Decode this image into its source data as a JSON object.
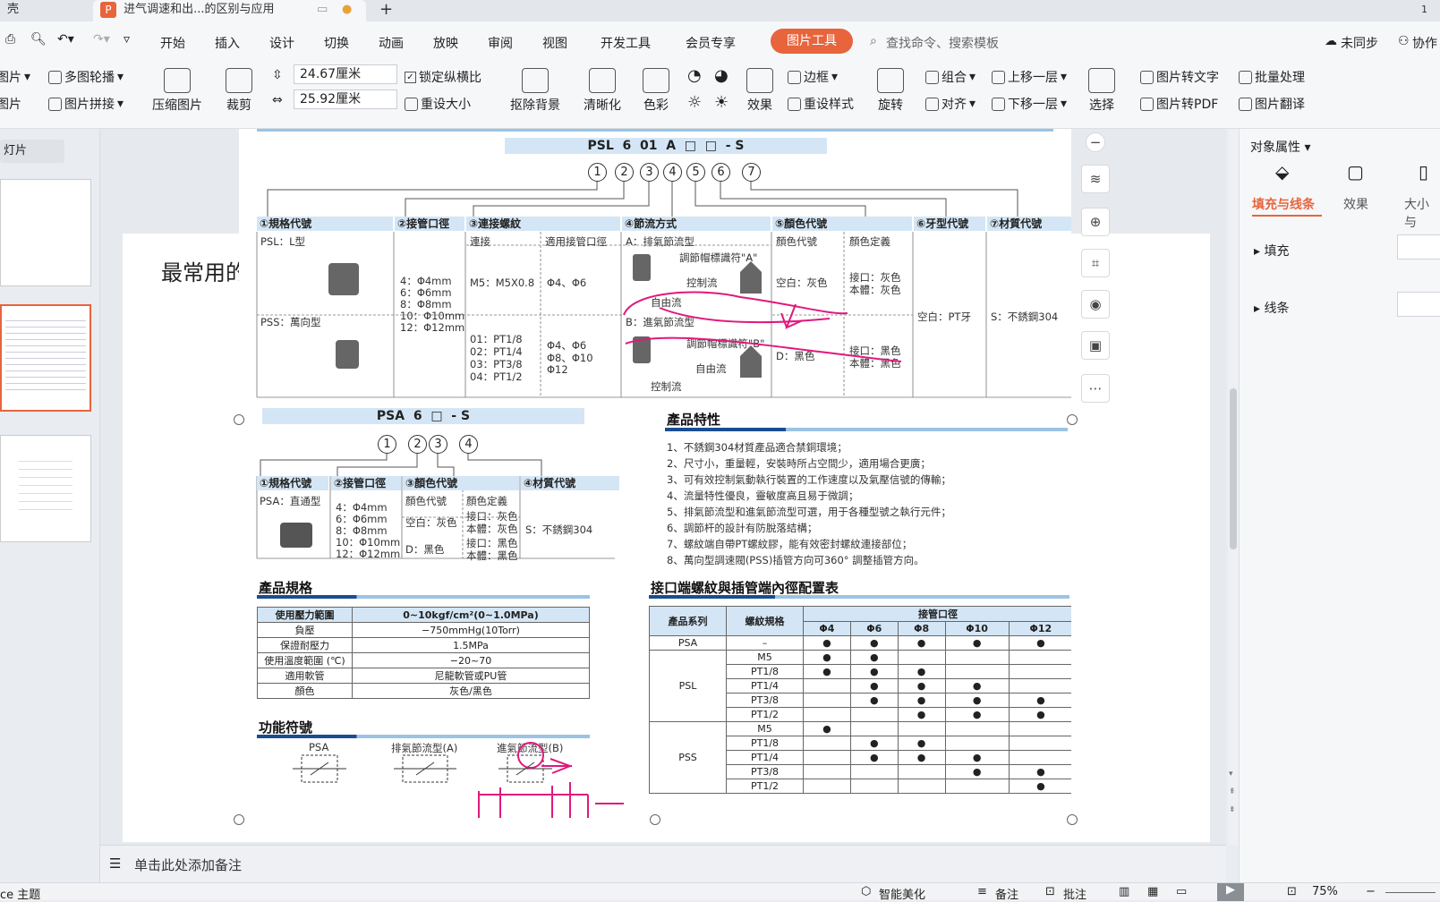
{
  "tabs": {
    "prev_partial": "壳",
    "active_title": "进气调速和出...的区别与应用",
    "new_tab": "+",
    "window_counter": "1"
  },
  "menubar": {
    "items": [
      "开始",
      "插入",
      "设计",
      "切换",
      "动画",
      "放映",
      "审阅",
      "视图",
      "开发工具",
      "会员专享"
    ],
    "active_tool_tab": "图片工具",
    "search_placeholder": "查找命令、搜索模板",
    "sync": "未同步",
    "collab": "协作"
  },
  "ribbon": {
    "left": [
      "图片",
      "图片",
      "多图轮播",
      "图片拼接",
      "压缩图片",
      "裁剪"
    ],
    "width_value": "24.67厘米",
    "height_value": "25.92厘米",
    "lock_ratio": "锁定纵横比",
    "resize": "重设大小",
    "remove_bg": "抠除背景",
    "sharpen": "清晰化",
    "color": "色彩",
    "effects": "效果",
    "border": "边框",
    "reset_style": "重设样式",
    "rotate": "旋转",
    "group": "组合",
    "align": "对齐",
    "bring_forward": "上移一层",
    "send_backward": "下移一层",
    "select": "选择",
    "pic_to_text": "图片转文字",
    "batch": "批量处理",
    "pic_to_pdf": "图片转PDF",
    "pic_translate": "图片翻译"
  },
  "left_pane": {
    "header": "灯片"
  },
  "slide": {
    "title_partial": "最常用的"
  },
  "doc": {
    "psl_code": "PSL  6  01  A  □  □  - S",
    "psl_nums": [
      "1",
      "2",
      "3",
      "4",
      "5",
      "6",
      "7"
    ],
    "psl_headers": [
      "①規格代號",
      "②接管口徑",
      "③連接螺紋",
      "④節流方式",
      "⑤顏色代號",
      "⑥牙型代號",
      "⑦材質代號"
    ],
    "psl_L": "PSL：L型",
    "pss": "PSS：萬向型",
    "pipe_sizes": [
      "4：Φ4mm",
      "6：Φ6mm",
      "8：Φ8mm",
      "10：Φ10mm",
      "12：Φ12mm"
    ],
    "thread_sub": [
      "連接",
      "適用接管口徑"
    ],
    "thread_m5": "M5：M5X0.8",
    "thread_m5_fit": "Φ4、Φ6",
    "thread_pt": [
      "01：PT1/8",
      "02：PT1/4",
      "03：PT3/8",
      "04：PT1/2"
    ],
    "thread_pt_fit": [
      "Φ4、Φ6",
      "Φ8、Φ10",
      "Φ12"
    ],
    "flow_a": "A：排氣節流型",
    "flow_cap_a": "調節帽標識符\"A\"",
    "control_flow": "控制流",
    "free_flow": "自由流",
    "flow_b": "B：進氣節流型",
    "flow_cap_b": "調節帽標識符\"B\"",
    "color_sub": [
      "顏色代號",
      "顏色定義"
    ],
    "color_blank": "空白：灰色",
    "color_def_grey": [
      "接口：灰色",
      "本體：灰色"
    ],
    "color_d": "D：黑色",
    "color_def_black": [
      "接口：黑色",
      "本體：黑色"
    ],
    "thread_type": "空白：PT牙",
    "material": "S：不銹鋼304",
    "psa_code": "PSA  6  □  - S",
    "psa_nums": [
      "1",
      "2",
      "3",
      "4"
    ],
    "psa_headers": [
      "①規格代號",
      "②接管口徑",
      "③顏色代號",
      "④材質代號"
    ],
    "psa_straight": "PSA：直通型",
    "psa_material": "S：不銹鋼304",
    "features_title": "產品特性",
    "features": [
      "1、不銹鋼304材質產品適合禁銅環境；",
      "2、尺寸小，重量輕，安裝時所占空間少，適用場合更廣；",
      "3、可有效控制氣動執行裝置的工作速度以及氣壓信號的傳輸；",
      "4、流量特性優良，靈敏度高且易于微調；",
      "5、排氣節流型和進氣節流型可選，用于各種型號之執行元件；",
      "6、調節杆的設計有防脫落結構；",
      "7、螺紋端自帶PT螺紋膠，能有效密封螺紋連接部位；",
      "8、萬向型調速閥(PSS)插管方向可360° 調整插管方向。"
    ],
    "spec_title": "產品規格",
    "spec_rows": [
      [
        "使用壓力範圍",
        "0~10kgf/cm²(0~1.0MPa)"
      ],
      [
        "負壓",
        "−750mmHg(10Torr)"
      ],
      [
        "保證耐壓力",
        "1.5MPa"
      ],
      [
        "使用溫度範圍 (℃)",
        "−20~70"
      ],
      [
        "適用軟管",
        "尼龍軟管或PU管"
      ],
      [
        "顏色",
        "灰色/黑色"
      ]
    ],
    "func_title": "功能符號",
    "func_labels": [
      "PSA",
      "排氣節流型(A)",
      "進氣節流型(B)"
    ],
    "port_title": "接口端螺紋與插管端內徑配置表",
    "port_head": [
      "產品系列",
      "螺紋規格",
      "接管口徑"
    ],
    "port_sizes": [
      "Φ4",
      "Φ6",
      "Φ8",
      "Φ10",
      "Φ12"
    ],
    "port_rows": [
      [
        "PSA",
        "–",
        "●",
        "●",
        "●",
        "●",
        "●"
      ],
      [
        "PSL",
        "M5",
        "●",
        "●",
        "",
        "",
        ""
      ],
      [
        "",
        "PT1/8",
        "●",
        "●",
        "●",
        "",
        ""
      ],
      [
        "",
        "PT1/4",
        "",
        "●",
        "●",
        "●",
        ""
      ],
      [
        "",
        "PT3/8",
        "",
        "●",
        "●",
        "●",
        "●"
      ],
      [
        "",
        "PT1/2",
        "",
        "",
        "●",
        "●",
        "●"
      ],
      [
        "PSS",
        "M5",
        "●",
        "",
        "",
        "",
        ""
      ],
      [
        "",
        "PT1/8",
        "",
        "●",
        "●",
        "",
        ""
      ],
      [
        "",
        "PT1/4",
        "",
        "●",
        "●",
        "●",
        ""
      ],
      [
        "",
        "PT3/8",
        "",
        "",
        "",
        "●",
        "●"
      ],
      [
        "",
        "PT1/2",
        "",
        "",
        "",
        "",
        "●"
      ]
    ]
  },
  "right_panel": {
    "title": "对象属性",
    "tabs": [
      "填充与线条",
      "效果",
      "大小与"
    ],
    "sections": [
      "填充",
      "线条"
    ]
  },
  "notes": "单击此处添加备注",
  "status": {
    "theme": "ce 主题",
    "beautify": "智能美化",
    "notes_btn": "备注",
    "comment": "批注",
    "zoom": "75%"
  },
  "colors": {
    "accent": "#e8643c",
    "brand": "#1a4d8f",
    "ink": "#e0197d"
  }
}
